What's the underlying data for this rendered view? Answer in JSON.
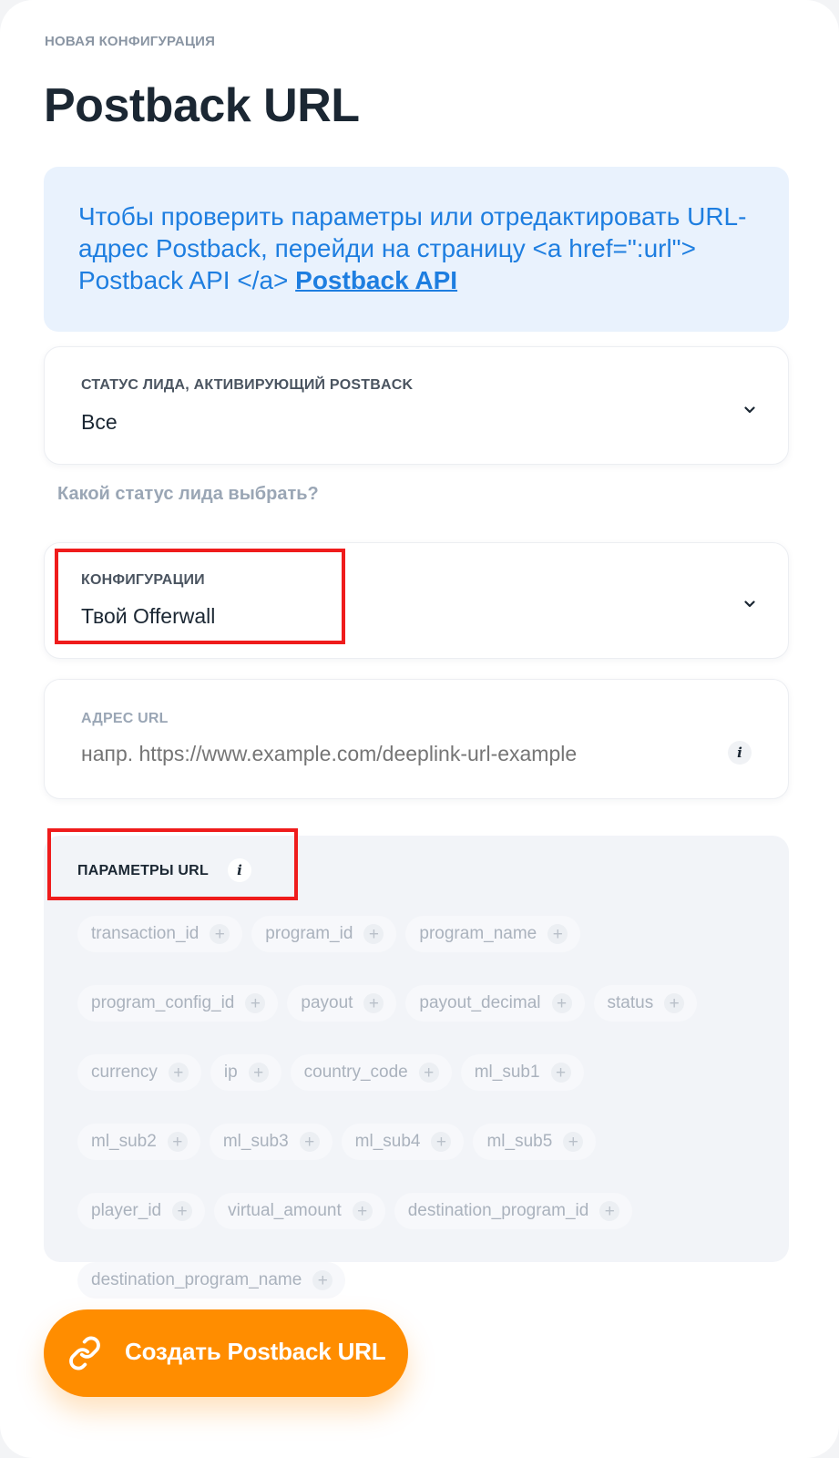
{
  "header": {
    "eyebrow": "НОВАЯ КОНФИГУРАЦИЯ",
    "title": "Postback URL"
  },
  "info_box": {
    "text": "Чтобы проверить параметры или отредактировать URL-адрес Postback, перейди на страницу <a href=\":url\"> Postback API </a> ",
    "link_label": "Postback API"
  },
  "lead_status": {
    "label": "СТАТУС ЛИДА, АКТИВИРУЮЩИЙ POSTBACK",
    "value": "Все"
  },
  "hint": "Какой статус лида выбрать?",
  "configuration": {
    "label": "КОНФИГУРАЦИИ",
    "value": "Твой Offerwall"
  },
  "url_field": {
    "label": "АДРЕС URL",
    "placeholder": "напр. https://www.example.com/deeplink-url-example"
  },
  "parameters": {
    "title": "ПАРАМЕТРЫ URL",
    "items": [
      "transaction_id",
      "program_id",
      "program_name",
      "program_config_id",
      "payout",
      "payout_decimal",
      "status",
      "currency",
      "ip",
      "country_code",
      "ml_sub1",
      "ml_sub2",
      "ml_sub3",
      "ml_sub4",
      "ml_sub5",
      "player_id",
      "virtual_amount",
      "destination_program_id",
      "destination_program_name"
    ]
  },
  "cta": {
    "label": "Создать Postback URL",
    "icon": "link-icon"
  },
  "colors": {
    "accent_orange": "#ff8d00",
    "link_blue": "#1e7ee0",
    "highlight_red": "#ef1c1c"
  }
}
